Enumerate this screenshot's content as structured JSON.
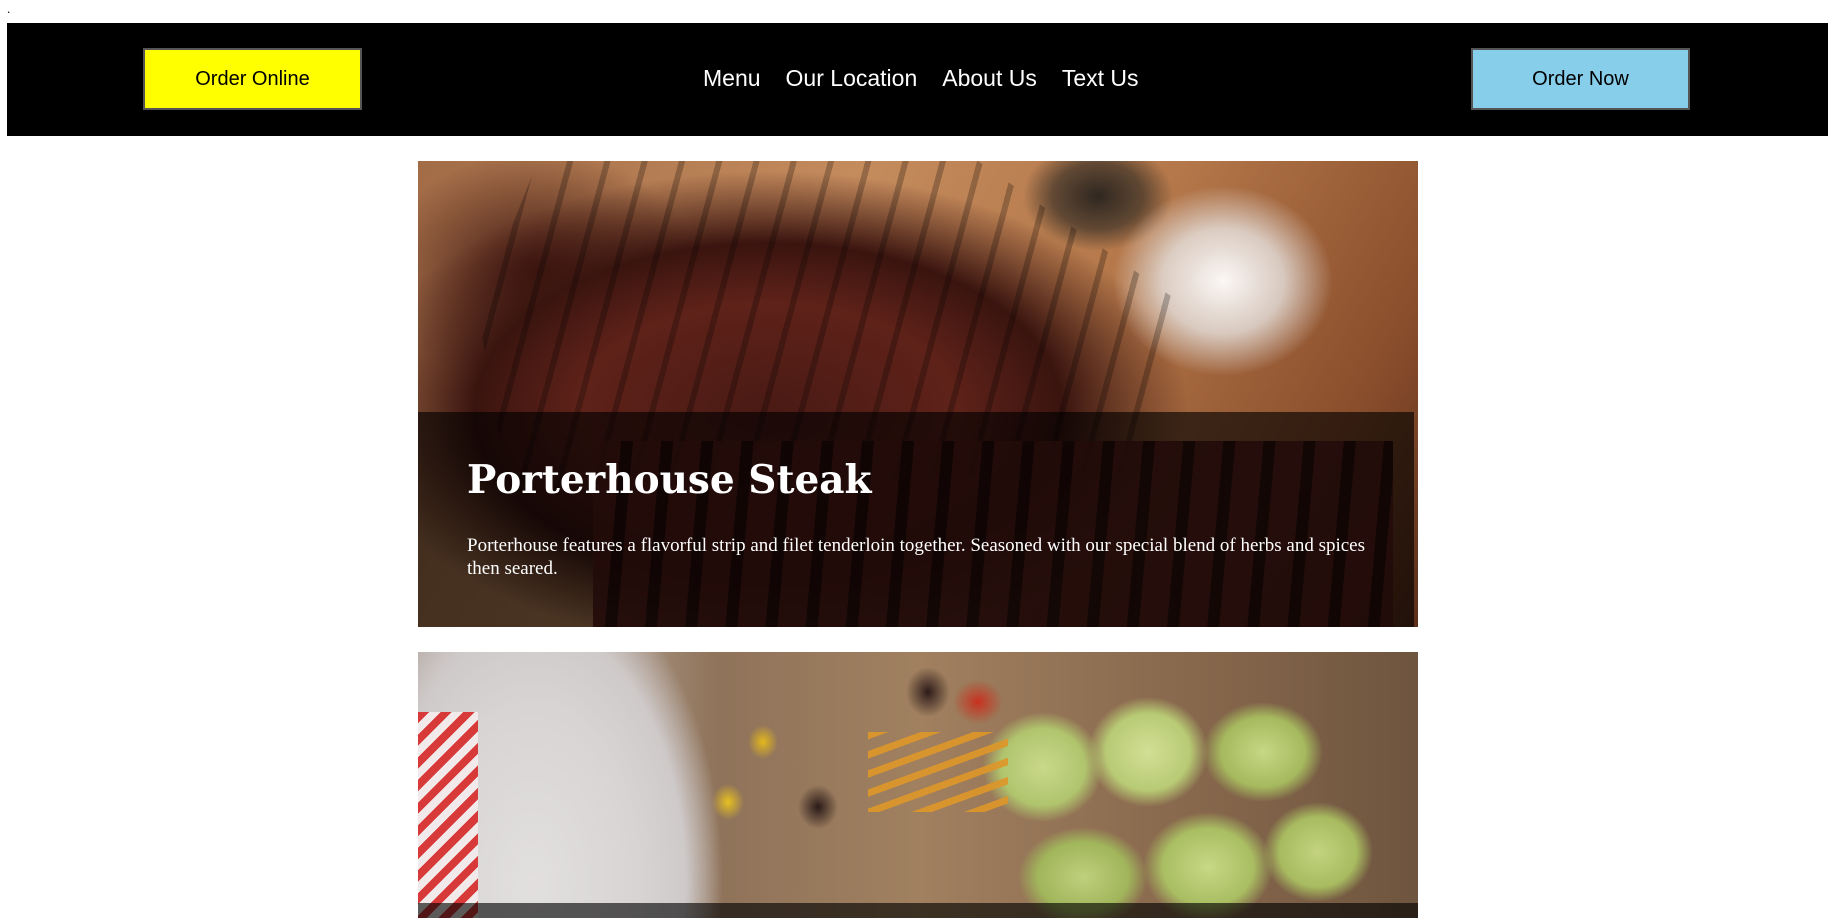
{
  "stray_mark": ".",
  "navbar": {
    "order_online_label": "Order Online",
    "order_now_label": "Order Now",
    "links": [
      "Menu",
      "Our Location",
      "About Us",
      "Text Us"
    ]
  },
  "cards": [
    {
      "title": "Porterhouse Steak",
      "description": "Porterhouse features a flavorful strip and filet tenderloin together. Seasoned with our special blend of herbs and spices then seared."
    }
  ],
  "colors": {
    "navbar_bg": "#000000",
    "order_online_bg": "#ffff00",
    "order_now_bg": "#87ceeb",
    "nav_text": "#ffffff"
  }
}
